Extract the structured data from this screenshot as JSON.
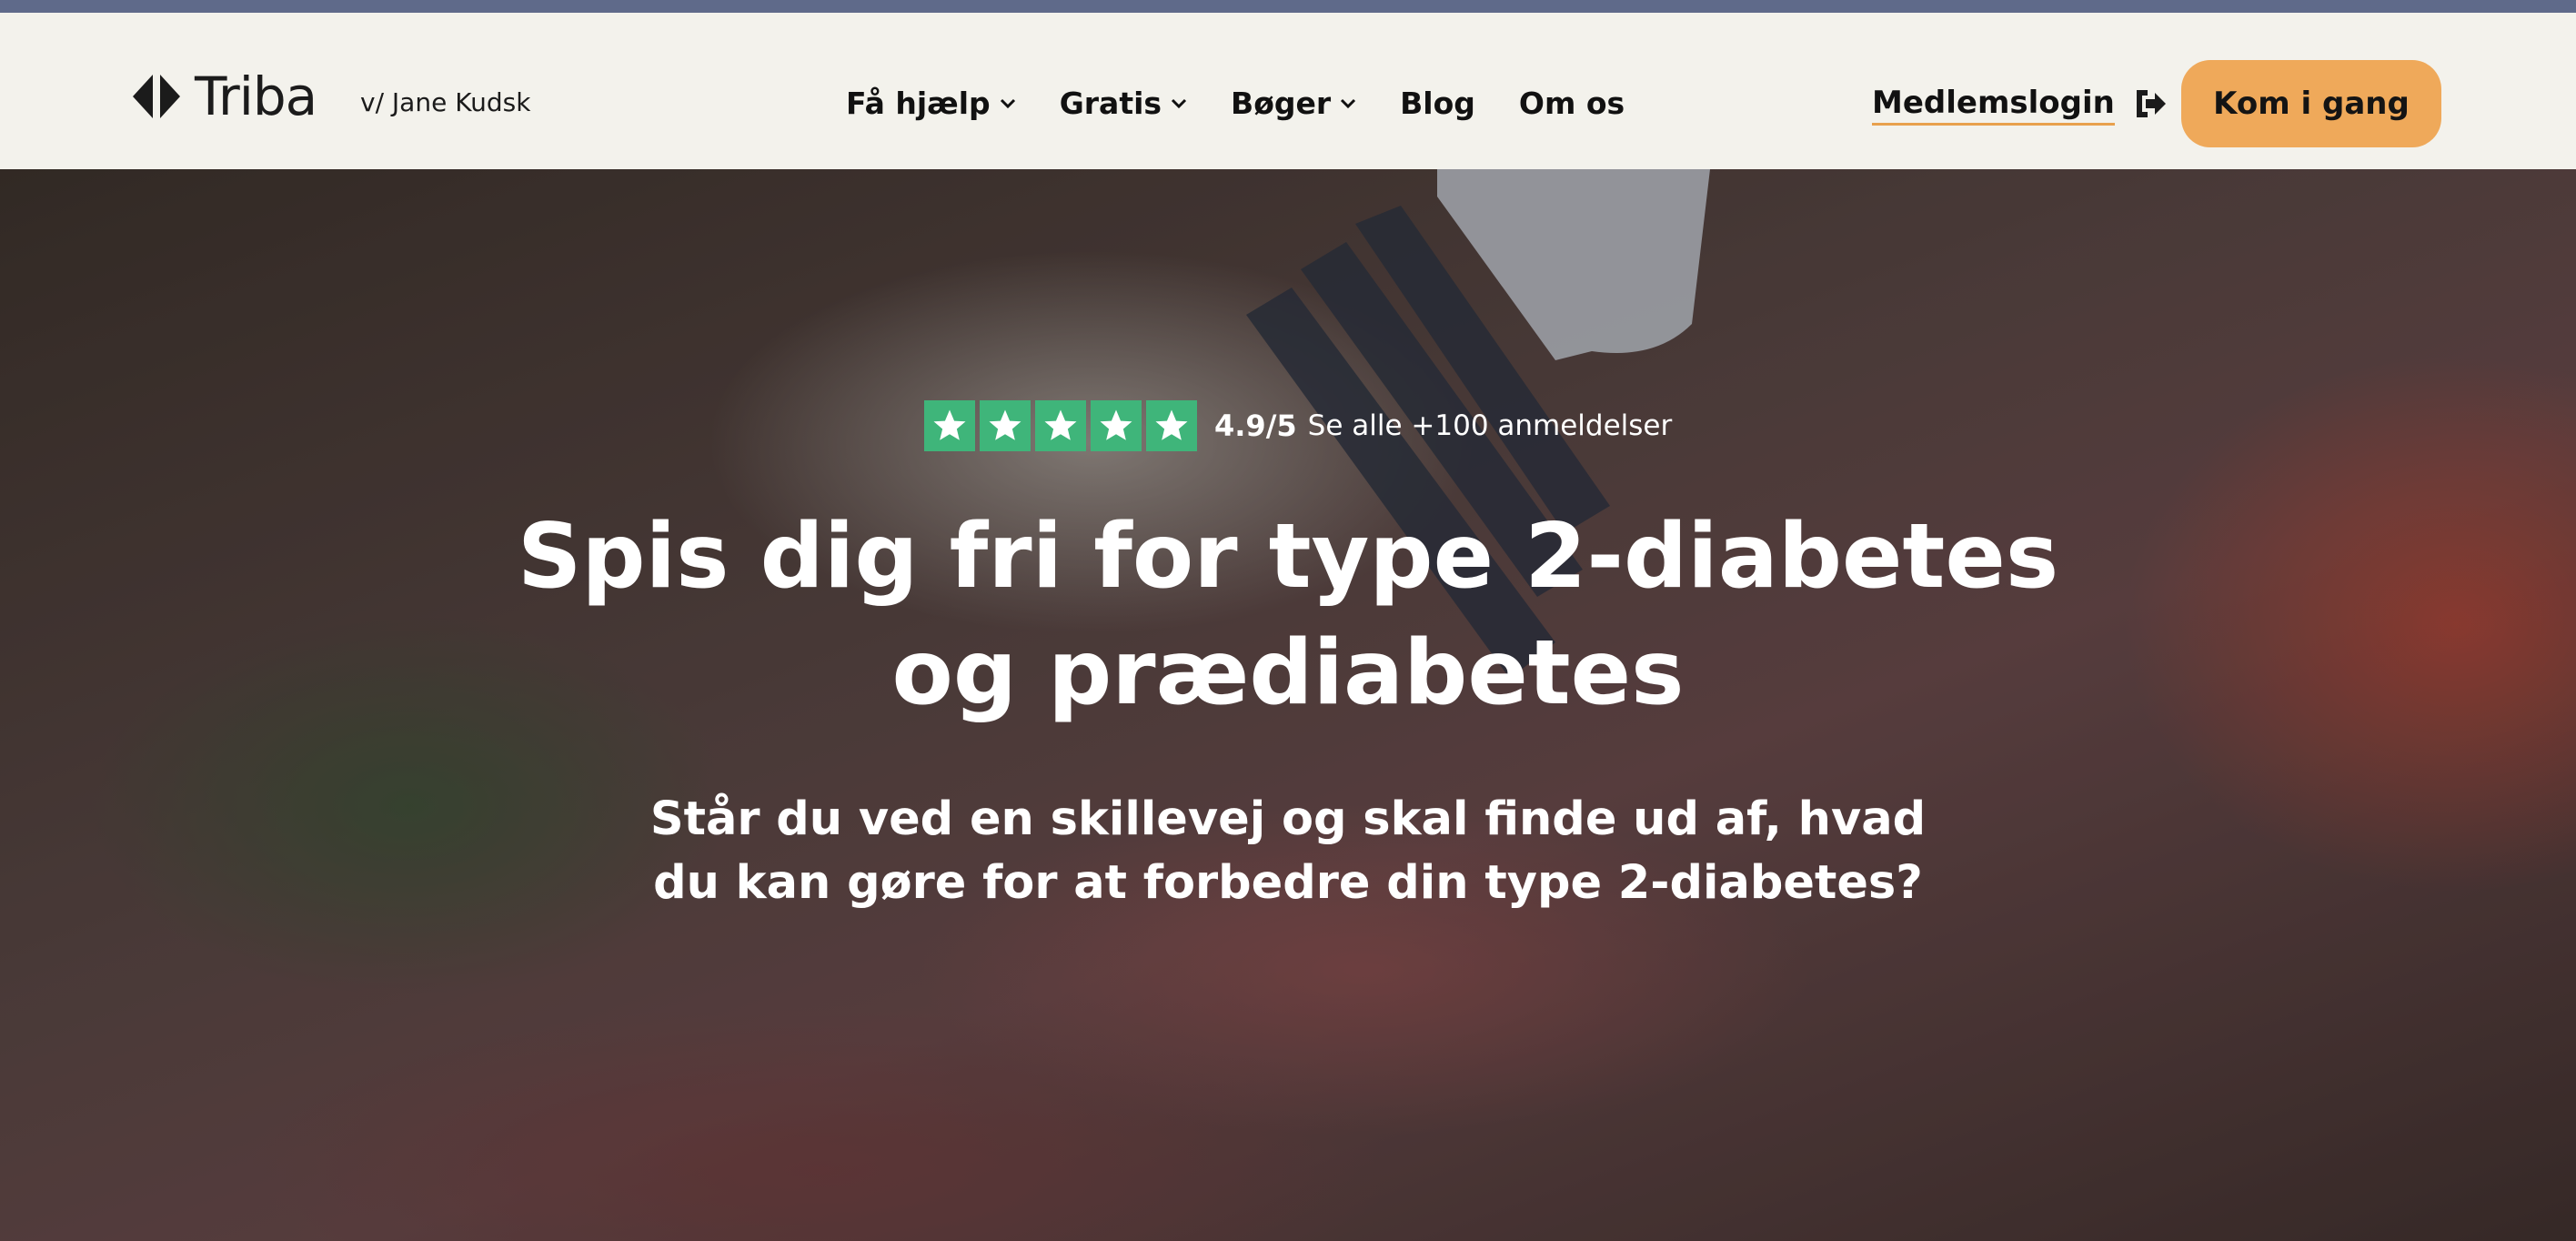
{
  "brand": {
    "name": "Triba",
    "byline": "v/ Jane Kudsk"
  },
  "nav": {
    "items": [
      {
        "label": "Få hjælp",
        "has_dropdown": true
      },
      {
        "label": "Gratis",
        "has_dropdown": true
      },
      {
        "label": "Bøger",
        "has_dropdown": true
      },
      {
        "label": "Blog",
        "has_dropdown": false
      },
      {
        "label": "Om os",
        "has_dropdown": false
      }
    ]
  },
  "header": {
    "login_label": "Medlemslogin",
    "login_icon": "sign-in-icon",
    "cta_label": "Kom i gang"
  },
  "hero": {
    "rating": {
      "stars": 5,
      "score": "4.9/5",
      "reviews_text": "Se alle +100 anmeldelser"
    },
    "title_line1": "Spis dig fri for type 2-diabetes",
    "title_line2": "og prædiabetes",
    "subtitle_line1": "Står du ved en skillevej og skal finde ud af, hvad",
    "subtitle_line2": "du kan gøre for at forbedre din type 2-diabetes?"
  },
  "colors": {
    "topbar": "#5f6a8a",
    "header_bg": "#f3f2ec",
    "accent": "#efa95a",
    "star_green": "#3fb57a"
  }
}
